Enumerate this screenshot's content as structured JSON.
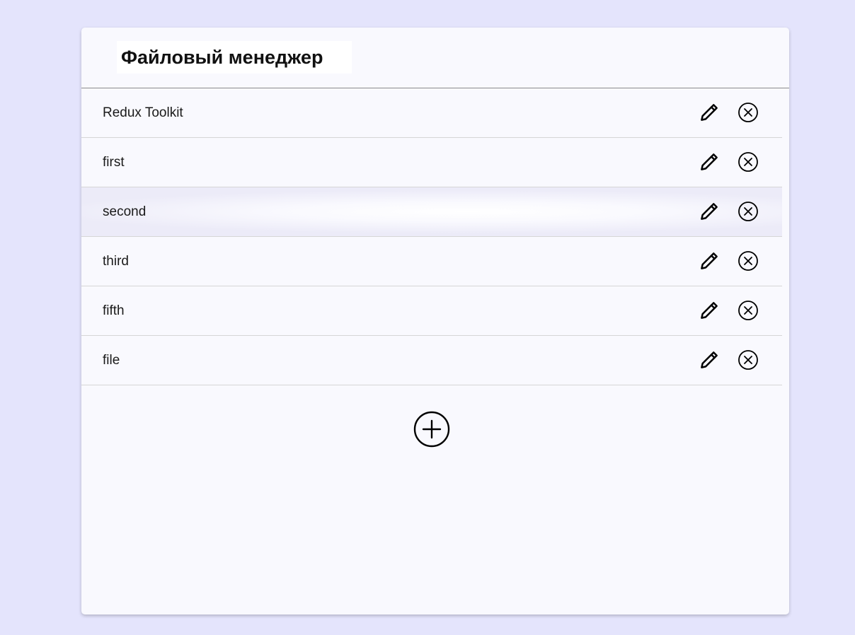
{
  "header": {
    "title": "Файловый менеджер"
  },
  "files": [
    {
      "name": "Redux Toolkit"
    },
    {
      "name": "first"
    },
    {
      "name": "second"
    },
    {
      "name": "third"
    },
    {
      "name": "fifth"
    },
    {
      "name": "file"
    }
  ],
  "icons": {
    "edit": "pencil-icon",
    "delete": "close-circle-icon",
    "add": "plus-circle-icon"
  },
  "colors": {
    "page_background": "#e4e4fc",
    "card_background": "#f9f9fe",
    "icon_color": "#000000"
  }
}
